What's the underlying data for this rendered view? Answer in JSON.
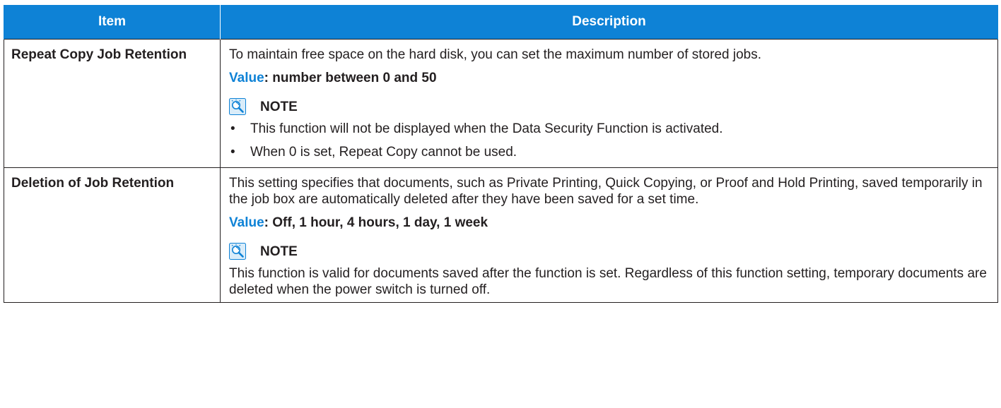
{
  "table": {
    "header_item": "Item",
    "header_description": "Description",
    "header_color": "#0e82d6"
  },
  "rows": [
    {
      "item": "Repeat Copy Job Retention",
      "description": "To maintain free space on the hard disk, you can set the maximum number of stored jobs.",
      "value_label": "Value",
      "value_text": ": number between 0 and 50",
      "note_icon": "note-magnifier-icon",
      "note_label": "NOTE",
      "note_bullets": [
        "This function will not be displayed when the Data Security Function is activated.",
        "When 0 is set, Repeat Copy cannot be used."
      ]
    },
    {
      "item": "Deletion of Job Retention",
      "description": "This setting specifies that documents, such as Private Printing, Quick Copying, or Proof and Hold Printing, saved temporarily in the job box are automatically deleted after they have been saved for a set time.",
      "value_label": "Value",
      "value_text": ": Off, 1 hour, 4 hours, 1 day, 1 week",
      "note_icon": "note-magnifier-icon",
      "note_label": "NOTE",
      "note_text": "This function is valid for documents saved after the function is set. Regardless of this function setting, temporary documents are deleted when the power switch is turned off."
    }
  ],
  "bullet_glyph": "•"
}
